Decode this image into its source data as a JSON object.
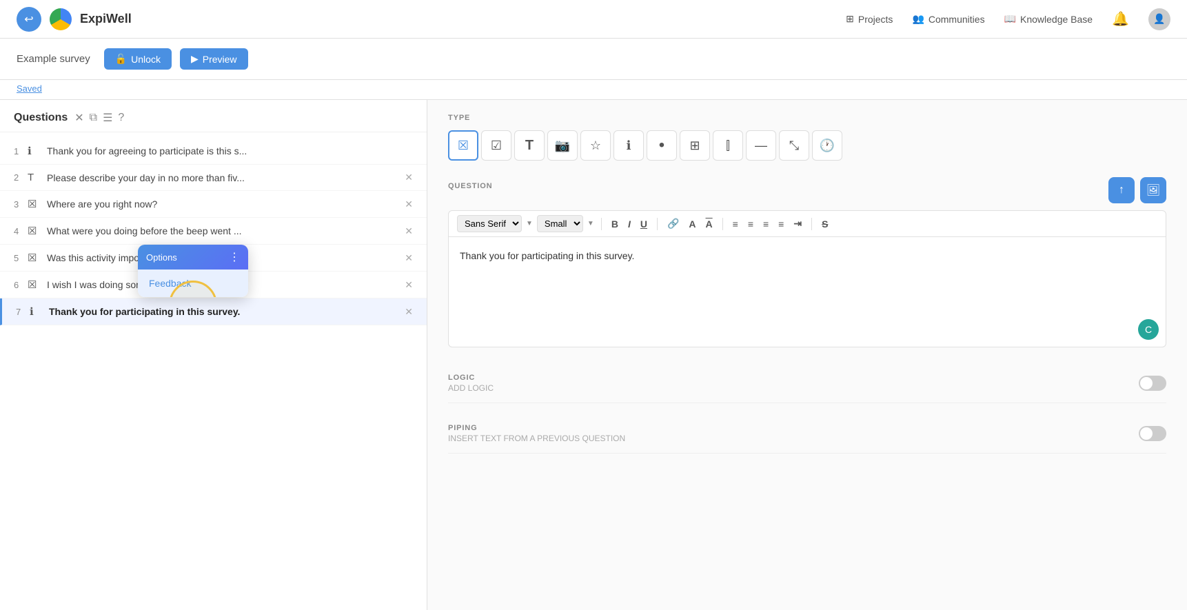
{
  "navbar": {
    "brand_name": "ExpiWell",
    "nav_items": [
      {
        "id": "projects",
        "label": "Projects",
        "icon": "⊞"
      },
      {
        "id": "communities",
        "label": "Communities",
        "icon": "👥"
      },
      {
        "id": "knowledge_base",
        "label": "Knowledge Base",
        "icon": "📖"
      }
    ]
  },
  "topbar": {
    "survey_title": "Example survey",
    "unlock_label": "Unlock",
    "preview_label": "Preview"
  },
  "saved_label": "Saved",
  "questions_panel": {
    "title": "Questions",
    "questions": [
      {
        "num": 1,
        "type": "info",
        "text": "Thank you for agreeing to participate is this s...",
        "active": false
      },
      {
        "num": 2,
        "type": "text",
        "text": "Please describe your day in no more than fiv...",
        "active": false
      },
      {
        "num": 3,
        "type": "choice",
        "text": "Where are you right now?",
        "active": false
      },
      {
        "num": 4,
        "type": "choice",
        "text": "What were you doing before the beep went ...",
        "active": false
      },
      {
        "num": 5,
        "type": "choice",
        "text": "Was this activity important to you?",
        "active": false
      },
      {
        "num": 6,
        "type": "choice",
        "text": "I wish I was doing something else.",
        "active": false
      },
      {
        "num": 7,
        "type": "info",
        "text": "Thank you for participating in this survey.",
        "active": true
      }
    ]
  },
  "popup": {
    "top_label": "Options",
    "dots_label": "⋮",
    "items": [
      {
        "label": "Feedback",
        "highlighted": true
      }
    ]
  },
  "right_panel": {
    "type_section_label": "TYPE",
    "type_icons": [
      {
        "id": "choice",
        "icon": "☒",
        "active": true
      },
      {
        "id": "checkbox",
        "icon": "☑",
        "active": false
      },
      {
        "id": "text",
        "icon": "T",
        "active": false
      },
      {
        "id": "photo",
        "icon": "📷",
        "active": false
      },
      {
        "id": "star",
        "icon": "☆",
        "active": false
      },
      {
        "id": "info",
        "icon": "ℹ",
        "active": false
      },
      {
        "id": "dot",
        "icon": "•",
        "active": false
      },
      {
        "id": "table",
        "icon": "⊞",
        "active": false
      },
      {
        "id": "vbar",
        "icon": "⫾",
        "active": false
      },
      {
        "id": "dash",
        "icon": "—",
        "active": false
      },
      {
        "id": "resize",
        "icon": "⤡",
        "active": false
      },
      {
        "id": "clock",
        "icon": "🕐",
        "active": false
      }
    ],
    "question_section_label": "QUESTION",
    "upload_icon": "↑",
    "image_icon": "🖼",
    "toolbar": {
      "font": "Sans Serif",
      "size": "Small",
      "bold": "B",
      "italic": "I",
      "underline": "U",
      "link": "🔗",
      "font_color": "A",
      "highlight": "A",
      "align_left": "≡",
      "align_center": "≡",
      "align_right": "≡",
      "justify": "≡",
      "indent": "⇥",
      "strikethrough": "S"
    },
    "editor_content": "Thank you for participating in this survey.",
    "logic_section_label": "LOGIC",
    "add_logic_label": "ADD LOGIC",
    "piping_section_label": "PIPING",
    "insert_text_label": "INSERT TEXT FROM A PREVIOUS QUESTION"
  }
}
